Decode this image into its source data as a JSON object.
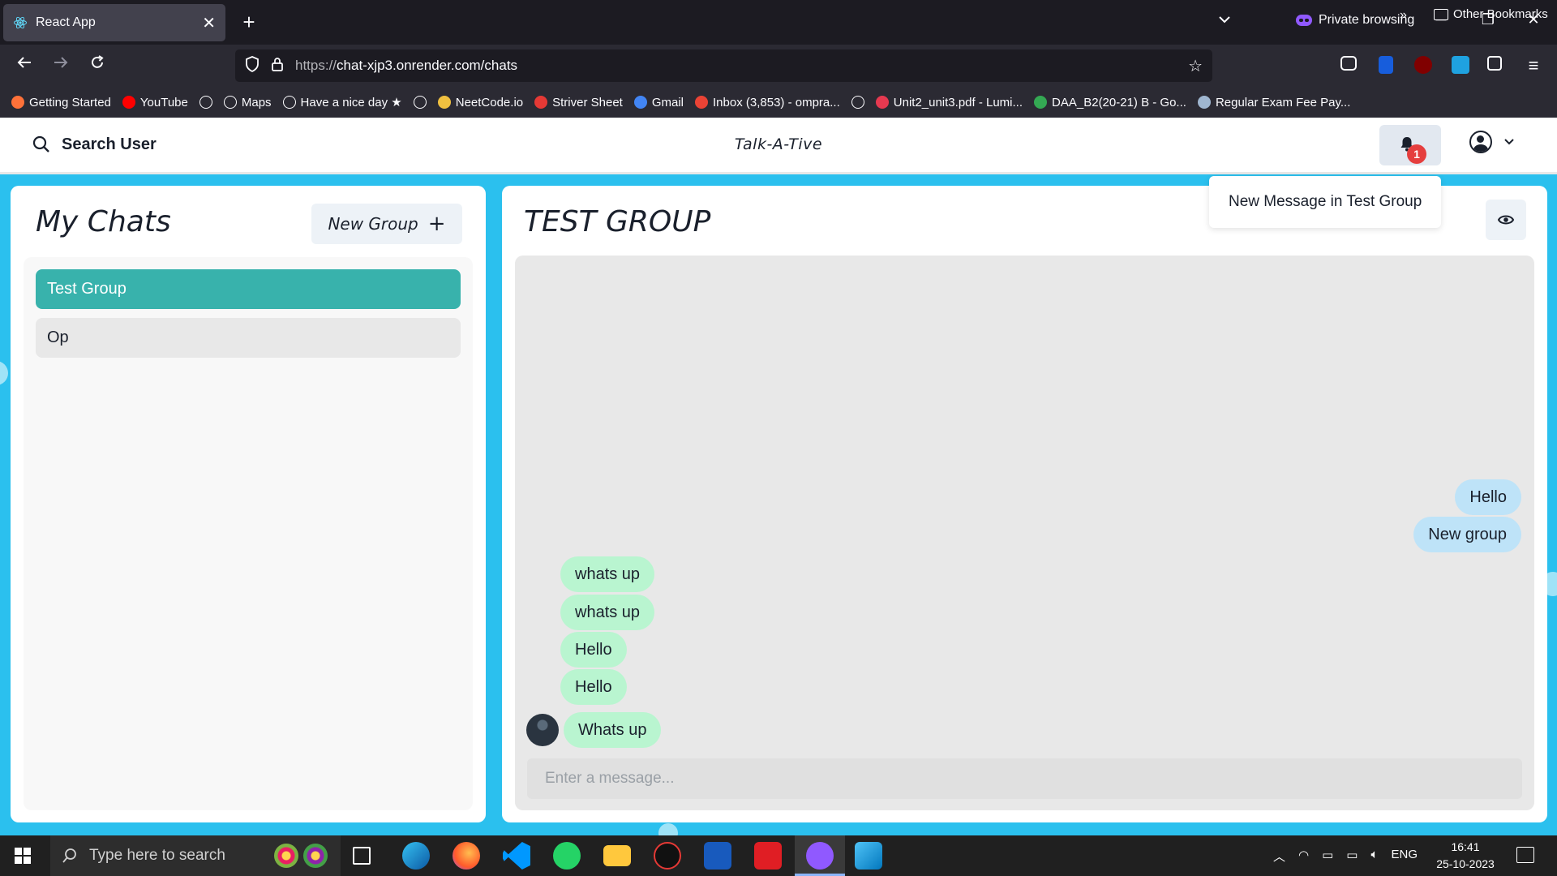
{
  "browser": {
    "tab_title": "React App",
    "private_label": "Private browsing",
    "url_prefix": "https://",
    "url_rest": "chat-xjp3.onrender.com/chats",
    "bookmarks": [
      {
        "label": "Getting Started",
        "icon": "firefox-icon",
        "color": "#ff7139"
      },
      {
        "label": "YouTube",
        "icon": "youtube-icon",
        "color": "#ff0000"
      },
      {
        "label": "",
        "icon": "globe-icon",
        "color": ""
      },
      {
        "label": "Maps",
        "icon": "globe-icon",
        "color": ""
      },
      {
        "label": "Have a nice day ★",
        "icon": "globe-icon",
        "color": ""
      },
      {
        "label": "",
        "icon": "globe-icon",
        "color": ""
      },
      {
        "label": "NeetCode.io",
        "icon": "neetcode-icon",
        "color": "#f0c040"
      },
      {
        "label": "Striver Sheet",
        "icon": "tuf-icon",
        "color": "#e53935"
      },
      {
        "label": "Gmail",
        "icon": "google-icon",
        "color": "#4285f4"
      },
      {
        "label": "Inbox (3,853) - ompra...",
        "icon": "gmail-icon",
        "color": "#ea4335"
      },
      {
        "label": "",
        "icon": "globe-icon",
        "color": ""
      },
      {
        "label": "Unit2_unit3.pdf - Lumi...",
        "icon": "lumin-icon",
        "color": "#e53950"
      },
      {
        "label": "DAA_B2(20-21) B - Go...",
        "icon": "drive-icon",
        "color": "#34a853"
      },
      {
        "label": "Regular Exam Fee Pay...",
        "icon": "page-icon",
        "color": "#9fb6d0"
      }
    ],
    "other_bookmarks": "Other Bookmarks"
  },
  "app": {
    "search_label": "Search User",
    "title": "Talk-A-Tive",
    "notification_count": "1",
    "notification_text": "New Message in Test Group"
  },
  "chats": {
    "title": "My Chats",
    "new_group_label": "New Group",
    "items": [
      {
        "name": "Test Group",
        "selected": true
      },
      {
        "name": "Op",
        "selected": false
      }
    ]
  },
  "conversation": {
    "title": "TEST GROUP",
    "messages": [
      {
        "text": "Hello",
        "mine": true
      },
      {
        "text": "New group",
        "mine": true
      },
      {
        "text": "whats up",
        "mine": false
      },
      {
        "text": "whats up",
        "mine": false
      },
      {
        "text": "Hello",
        "mine": false
      },
      {
        "text": "Hello",
        "mine": false
      },
      {
        "text": "Whats up",
        "mine": false
      }
    ],
    "input_placeholder": "Enter a message..."
  },
  "taskbar": {
    "search_placeholder": "Type here to search",
    "lang": "ENG",
    "time": "16:41",
    "date": "25-10-2023"
  },
  "colors": {
    "selected_chat": "#38b2ac",
    "unselected_chat": "#e8e8e8",
    "my_bubble": "#bee3f8",
    "their_bubble": "#b9f5d0",
    "page_bg": "#2bc0ee"
  }
}
